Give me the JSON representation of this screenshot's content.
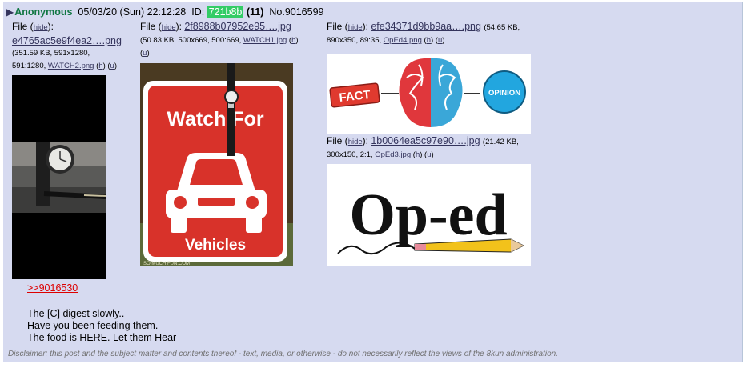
{
  "post": {
    "name": "Anonymous",
    "date": "05/03/20 (Sun) 22:12:28",
    "id_label": "ID:",
    "id": "721b8b",
    "count": "(11)",
    "number": "No.9016599"
  },
  "file_label": "File",
  "hide_label": "hide",
  "h_label": "h",
  "u_label": "u",
  "files": [
    {
      "name": "e4765ac5e9f4ea2….png",
      "size": "(351.59 KB, 591x1280,",
      "size2": "591:1280,",
      "orig": "WATCH2.png"
    },
    {
      "name": "2f8988b07952e95….jpg",
      "size": "(50.83 KB, 500x669, 500:669,",
      "orig": "WATCH1.jpg"
    },
    {
      "name": "efe34371d9bb9aa….png",
      "size": "(54.65 KB,",
      "size2": "890x350, 89:35,",
      "orig": "OpEd4.png"
    },
    {
      "name": "1b0064ea5c97e90….jpg",
      "size": "(21.42 KB,",
      "size2": "300x150, 2:1,",
      "orig": "OpEd3.jpg"
    }
  ],
  "images": {
    "watch_sign_text1": "Watch For",
    "watch_sign_text2": "Vehicles",
    "watch_credit": "SO MUCH FUN.COM",
    "fact_label": "FACT",
    "opinion_label": "OPINION",
    "oped_text": "Op-ed",
    "colors": {
      "sign_red": "#d8322a",
      "fact_red": "#e03a2f",
      "opinion_blue": "#22a6df"
    }
  },
  "body": {
    "quote": ">>9016530",
    "lines": [
      "The [C] digest slowly..",
      "Have you been feeding them.",
      "The food is HERE. Let them Hear"
    ]
  },
  "disclaimer": "Disclaimer: this post and the subject matter and contents thereof - text, media, or otherwise - do not necessarily reflect the views of the 8kun administration."
}
